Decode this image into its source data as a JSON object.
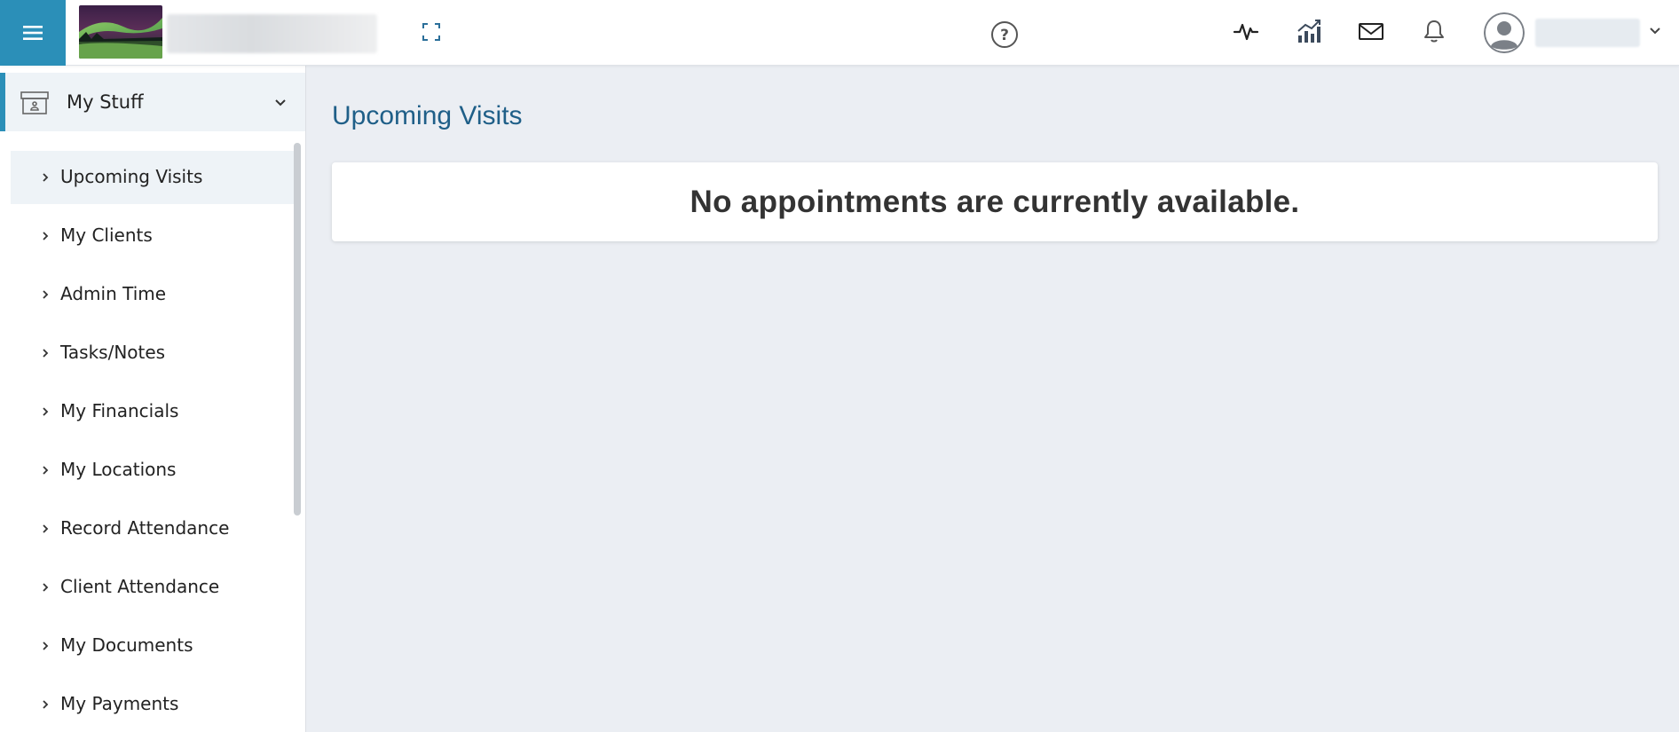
{
  "header": {
    "menu_icon": "hamburger-menu-icon",
    "logo_description": "aurora landscape logo",
    "fullscreen_icon": "fullscreen-icon",
    "help_icon": "help-circle-icon",
    "icons": [
      "activity-pulse-icon",
      "bar-chart-icon",
      "mail-icon",
      "bell-icon"
    ],
    "avatar_icon": "user-avatar-icon",
    "user_menu_icon": "chevron-down-icon",
    "accent_color": "#2b8fb8"
  },
  "sidebar": {
    "section": {
      "label": "My Stuff",
      "icon": "archive-box-icon",
      "expanded": true
    },
    "items": [
      {
        "label": "Upcoming Visits",
        "active": true
      },
      {
        "label": "My Clients"
      },
      {
        "label": "Admin Time"
      },
      {
        "label": "Tasks/Notes"
      },
      {
        "label": "My Financials"
      },
      {
        "label": "My Locations"
      },
      {
        "label": "Record Attendance"
      },
      {
        "label": "Client Attendance"
      },
      {
        "label": "My Documents"
      },
      {
        "label": "My Payments"
      }
    ]
  },
  "main": {
    "title": "Upcoming Visits",
    "empty_message": "No appointments are currently available.",
    "title_color": "#1f5f88"
  }
}
